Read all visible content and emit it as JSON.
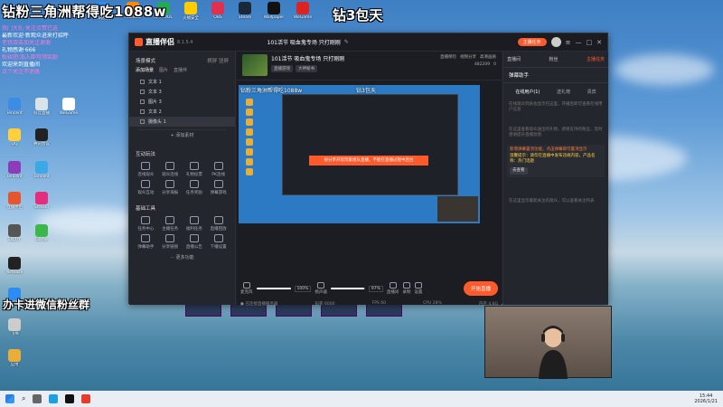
{
  "overlay": {
    "top_left": "钻粉三角洲帮得吃1088w",
    "top_right": "钻3包天",
    "bottom_left": "办卡进微信粉丝群",
    "chat_lines": [
      "热门大礼·关注点赞已送",
      "最新欢迎·新观众进来打招呼",
      "老铁双击加关注谢谢",
      "礼物感谢·666",
      "粉丝团·加入即可领奖励",
      "欢迎来到直播间",
      "点个关注不迷路"
    ]
  },
  "desktop": {
    "top_icons": [
      "腾讯视频",
      "Yuanbao",
      "DIYTOOL",
      "火绒安全",
      "OBS",
      "Steam",
      "Wallpaper",
      "WeGame"
    ],
    "left_icons": [
      "Tencent",
      "抖音直播",
      "WeGame",
      "QQ",
      "腾讯会议",
      "Tencent",
      "Tencent",
      "直播伴侣",
      "Stream",
      "ENJOY",
      "Game",
      "Netease",
      "WeChat",
      "飞书",
      "应用"
    ]
  },
  "app": {
    "name": "直播伴侣",
    "version": "8.1.5.4",
    "stream_title": "101活节 吸血鬼专场 只打刚刚",
    "top_pill": "主播任务",
    "left": {
      "scene_header": "场景模式",
      "scene_sub": "横屏 竖屏",
      "source_tabs": [
        "添加场景",
        "图片",
        "直播伴"
      ],
      "scenes": [
        "文本 1",
        "文本 3",
        "图片 3",
        "文本 2",
        "摄像头 1"
      ],
      "add_source": "+ 添加素材",
      "interact_header": "互动玩法",
      "interact_items": [
        "连线观众",
        "观众连线",
        "礼物投票",
        "PK连线",
        "观众互动",
        "分享海报",
        "任务奖励",
        "弹幕游戏"
      ],
      "tools_header": "基础工具",
      "tools_items": [
        "任务中心",
        "主播任务",
        "福利任务",
        "直播回放",
        "弹幕助手",
        "分享链接",
        "直播公告",
        "下播设置"
      ],
      "more": "··· 更多功能"
    },
    "center": {
      "tags": [
        "直播游戏",
        "大神秘书"
      ],
      "stats": [
        "直播保险",
        "视频分享",
        "高清画质"
      ],
      "viewers": "482209",
      "likes": "0",
      "preview_title": "钻粉三角洲帮得吃1088w",
      "preview_right": "钻3包天",
      "warn": "按分享开玩玩家组队直播，不能在直播过程中后台",
      "mic_pct": "100%",
      "sys_pct": "97%",
      "mic_label": "麦克风",
      "sys_label": "扬声器",
      "ctrls": [
        "直播间",
        "录制",
        "设置"
      ],
      "go_live": "开始直播",
      "status": [
        "● 已连接直播服务器",
        "码率 6000",
        "FPS 60",
        "CPU 28%",
        "内存 4.6G"
      ]
    },
    "right": {
      "top": [
        "直播间",
        "粉丝",
        "主播任务"
      ],
      "head": "弹幕助手",
      "tabs": [
        "在线用户(1)",
        "送礼榜",
        "贵宾"
      ],
      "empty_text": "在线观众列表会显示在这里，开播后即可查看在线用户信息",
      "gift_text": "在这里查看观众送出的礼物，感谢支持的粉丝，及时感谢提升直播氛围",
      "tip_text": "新增弹幕置顶功能，点击弹幕即可置顶显示",
      "tip_yellow": "温馨提示：请勿在直播中发布违规内容，产品名称：热门话题",
      "tip_btn": "去查看",
      "bottom_text": "在这里显示最新关注的观众，可以查看关注列表"
    }
  },
  "taskbar": {
    "time": "15:44",
    "date": "2026/1/21"
  }
}
